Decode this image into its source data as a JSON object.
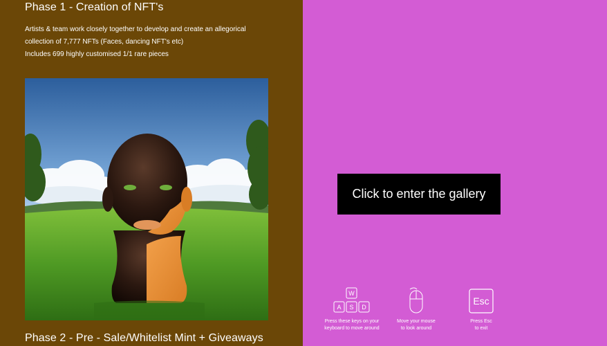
{
  "roadmap": {
    "phase1": {
      "title": "Phase 1 - Creation of NFT's",
      "description_lines": [
        "Artists & team work closely together to develop and create an allegorical",
        "collection of 7,777 NFTs (Faces, dancing NFT's etc)",
        "Includes 699 highly customised 1/1 rare pieces"
      ],
      "image": "nft-bust-artwork"
    },
    "phase2": {
      "title": "Phase 2 - Pre - Sale/Whitelist Mint + Giveaways"
    }
  },
  "gallery": {
    "enter_label": "Click to enter the gallery",
    "hints": {
      "keys": {
        "icon": "wasd-keys-icon",
        "keys": [
          "W",
          "A",
          "S",
          "D"
        ],
        "lines": [
          "Press these keys on your",
          "keyboard to move around"
        ]
      },
      "mouse": {
        "icon": "mouse-icon",
        "lines": [
          "Move your mouse",
          "to look around"
        ]
      },
      "esc": {
        "icon": "esc-key-icon",
        "key": "Esc",
        "lines": [
          "Press Esc",
          "to exit"
        ]
      }
    }
  },
  "colors": {
    "left_panel": "#6b4707",
    "right_panel": "#d35cd4",
    "button": "#000000",
    "text": "#ffffff"
  }
}
